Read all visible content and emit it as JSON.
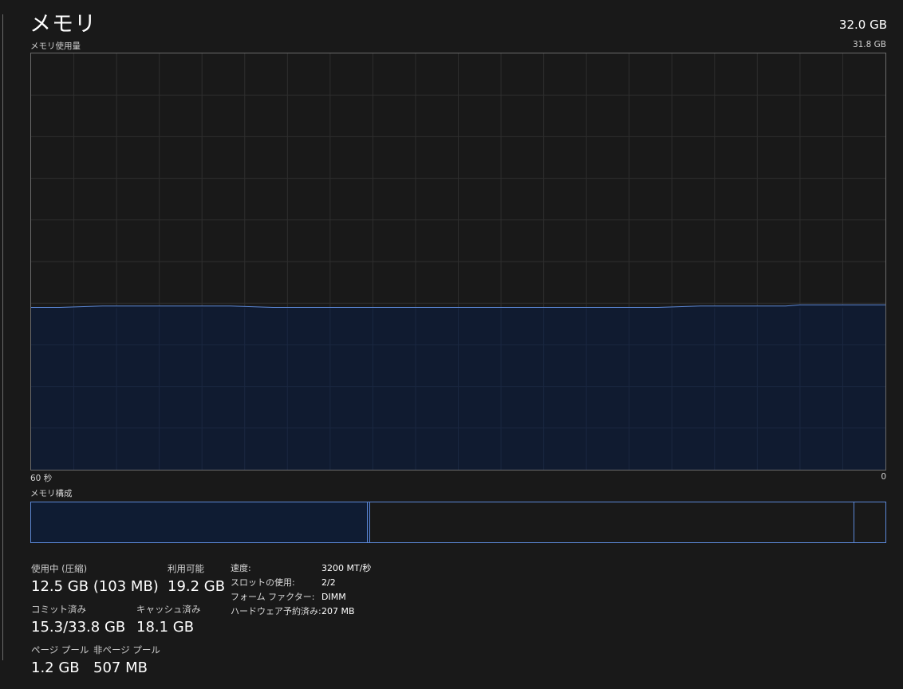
{
  "header": {
    "title": "メモリ",
    "total": "32.0 GB"
  },
  "graph": {
    "label": "メモリ使用量",
    "max_label": "31.8 GB",
    "time_left": "60 秒",
    "time_right": "0",
    "line_color": "#5b87d6",
    "fill_color": "#0f1c33"
  },
  "chart_data": {
    "type": "area",
    "title": "メモリ使用量",
    "xlabel": "",
    "ylabel": "",
    "x": [
      60,
      58,
      55,
      52,
      49,
      46,
      43,
      40,
      37,
      34,
      31,
      28,
      25,
      22,
      19,
      16,
      13,
      10,
      8,
      7,
      6,
      5,
      4,
      2,
      0
    ],
    "y": [
      12.4,
      12.4,
      12.5,
      12.5,
      12.5,
      12.5,
      12.4,
      12.4,
      12.4,
      12.4,
      12.4,
      12.4,
      12.4,
      12.4,
      12.4,
      12.4,
      12.5,
      12.5,
      12.5,
      12.5,
      12.6,
      12.6,
      12.6,
      12.6,
      12.6
    ],
    "xlim": [
      60,
      0
    ],
    "ylim": [
      0,
      31.8
    ],
    "grid": true
  },
  "composition": {
    "label": "メモリ構成",
    "in_use_fraction": 0.394,
    "modified_fraction": 0.003,
    "standby_fraction": 0.567,
    "free_fraction": 0.036
  },
  "stats": {
    "in_use": {
      "label": "使用中 (圧縮)",
      "value": "12.5 GB (103 MB)"
    },
    "available": {
      "label": "利用可能",
      "value": "19.2 GB"
    },
    "committed": {
      "label": "コミット済み",
      "value": "15.3/33.8 GB"
    },
    "cached": {
      "label": "キャッシュ済み",
      "value": "18.1 GB"
    },
    "paged_pool": {
      "label": "ページ プール",
      "value": "1.2 GB"
    },
    "nonpaged_pool": {
      "label": "非ページ プール",
      "value": "507 MB"
    }
  },
  "specs": [
    {
      "key": "速度:",
      "value": "3200 MT/秒"
    },
    {
      "key": "スロットの使用:",
      "value": "2/2"
    },
    {
      "key": "フォーム ファクター:",
      "value": "DIMM"
    },
    {
      "key": "ハードウェア予約済み:",
      "value": "207 MB"
    }
  ]
}
